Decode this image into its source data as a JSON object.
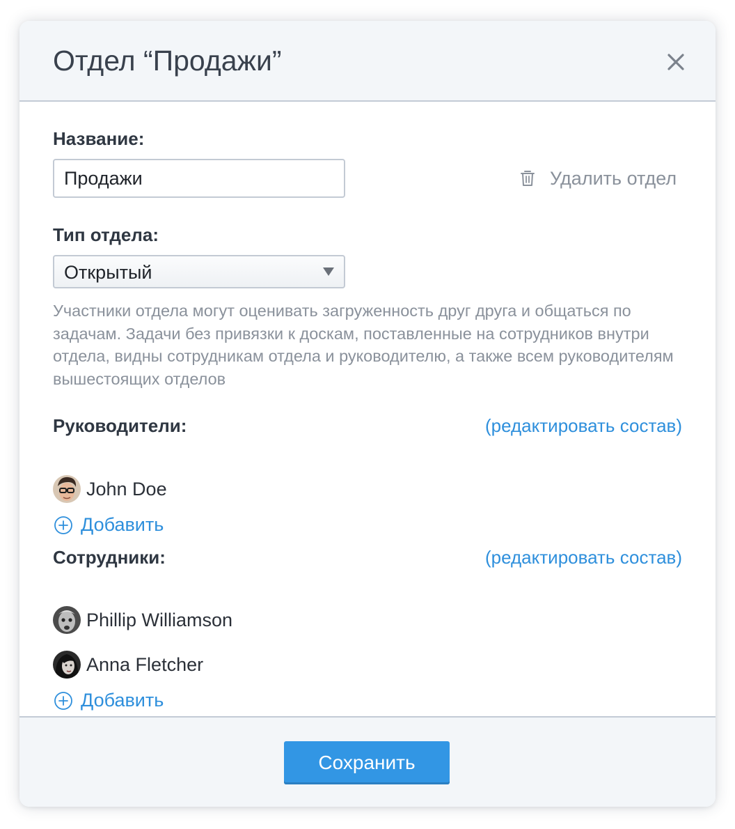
{
  "dialog": {
    "title": "Отдел “Продажи”",
    "close_icon": "close-icon"
  },
  "name_field": {
    "label": "Название:",
    "value": "Продажи"
  },
  "delete_department": {
    "label": "Удалить отдел",
    "icon": "trash-icon"
  },
  "department_type": {
    "label": "Тип отдела:",
    "selected": "Открытый",
    "description": "Участники отдела могут оценивать загруженность друг друга и общаться по задачам. Задачи без привязки к доскам, поставленные на сотрудников внутри отдела, видны сотрудникам отдела и руководителю, а также всем руководителям вышестоящих отделов"
  },
  "managers": {
    "label": "Руководители:",
    "edit_label": "(редактировать состав)",
    "members": [
      {
        "name": "John Doe",
        "avatar": "avatar-john-doe"
      }
    ],
    "add_label": "Добавить"
  },
  "employees": {
    "label": "Сотрудники:",
    "edit_label": "(редактировать состав)",
    "members": [
      {
        "name": "Phillip Williamson",
        "avatar": "avatar-phillip-williamson"
      },
      {
        "name": "Anna Fletcher",
        "avatar": "avatar-anna-fletcher"
      }
    ],
    "add_label": "Добавить"
  },
  "footer": {
    "save_label": "Сохранить"
  },
  "colors": {
    "accent": "#3296e4",
    "link": "#2e8fdc",
    "header_bg": "#f3f6f9",
    "muted_text": "#8a919b"
  }
}
